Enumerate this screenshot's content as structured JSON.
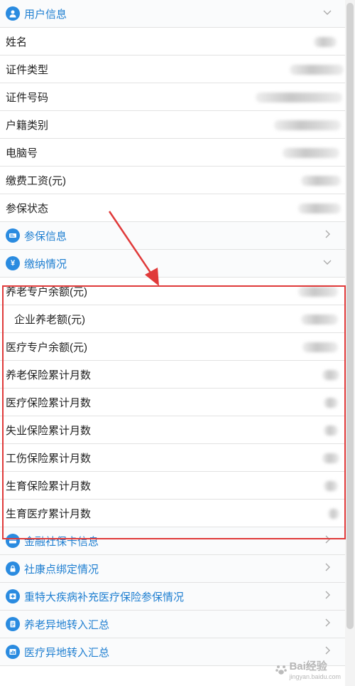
{
  "user_info": {
    "title": "用户信息",
    "fields": [
      "姓名",
      "证件类型",
      "证件号码",
      "户籍类别",
      "电脑号",
      "缴费工资(元)",
      "参保状态"
    ]
  },
  "insurance_info": {
    "title": "参保信息"
  },
  "payment": {
    "title": "缴纳情况",
    "fields": [
      "养老专户余额(元)",
      "企业养老额(元)",
      "医疗专户余额(元)",
      "养老保险累计月数",
      "医疗保险累计月数",
      "失业保险累计月数",
      "工伤保险累计月数",
      "生育保险累计月数",
      "生育医疗累计月数"
    ]
  },
  "sections": [
    "金融社保卡信息",
    "社康点绑定情况",
    "重特大疾病补充医疗保险参保情况",
    "养老异地转入汇总",
    "医疗异地转入汇总"
  ],
  "icons": {
    "user_info": "user-icon",
    "insurance_info": "card-icon",
    "payment": "yen-icon",
    "sections": [
      "bank-card-icon",
      "lock-icon",
      "medical-cross-icon",
      "document-icon",
      "chart-icon"
    ]
  },
  "watermark": {
    "text": "Bai经验",
    "sub": "jingyan.baidu.com"
  },
  "colors": {
    "accent": "#2a8be0",
    "highlight": "#e03a3a"
  }
}
